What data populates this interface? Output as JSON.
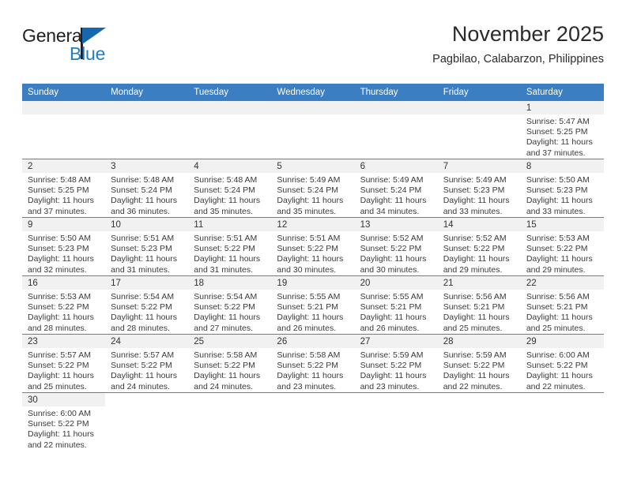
{
  "brand": {
    "name_dark": "General",
    "name_blue": "Blue",
    "accent_blue": "#1f7ec4",
    "header_blue": "#3b7ec1"
  },
  "header": {
    "title": "November 2025",
    "subtitle": "Pagbilao, Calabarzon, Philippines"
  },
  "weekdays": [
    "Sunday",
    "Monday",
    "Tuesday",
    "Wednesday",
    "Thursday",
    "Friday",
    "Saturday"
  ],
  "labels": {
    "sunrise_prefix": "Sunrise: ",
    "sunset_prefix": "Sunset: ",
    "daylight_prefix": "Daylight: "
  },
  "weeks": [
    [
      {
        "day": "",
        "empty": true
      },
      {
        "day": "",
        "empty": true
      },
      {
        "day": "",
        "empty": true
      },
      {
        "day": "",
        "empty": true
      },
      {
        "day": "",
        "empty": true
      },
      {
        "day": "",
        "empty": true
      },
      {
        "day": "1",
        "sunrise": "Sunrise: 5:47 AM",
        "sunset": "Sunset: 5:25 PM",
        "daylight": "Daylight: 11 hours and 37 minutes."
      }
    ],
    [
      {
        "day": "2",
        "sunrise": "Sunrise: 5:48 AM",
        "sunset": "Sunset: 5:25 PM",
        "daylight": "Daylight: 11 hours and 37 minutes."
      },
      {
        "day": "3",
        "sunrise": "Sunrise: 5:48 AM",
        "sunset": "Sunset: 5:24 PM",
        "daylight": "Daylight: 11 hours and 36 minutes."
      },
      {
        "day": "4",
        "sunrise": "Sunrise: 5:48 AM",
        "sunset": "Sunset: 5:24 PM",
        "daylight": "Daylight: 11 hours and 35 minutes."
      },
      {
        "day": "5",
        "sunrise": "Sunrise: 5:49 AM",
        "sunset": "Sunset: 5:24 PM",
        "daylight": "Daylight: 11 hours and 35 minutes."
      },
      {
        "day": "6",
        "sunrise": "Sunrise: 5:49 AM",
        "sunset": "Sunset: 5:24 PM",
        "daylight": "Daylight: 11 hours and 34 minutes."
      },
      {
        "day": "7",
        "sunrise": "Sunrise: 5:49 AM",
        "sunset": "Sunset: 5:23 PM",
        "daylight": "Daylight: 11 hours and 33 minutes."
      },
      {
        "day": "8",
        "sunrise": "Sunrise: 5:50 AM",
        "sunset": "Sunset: 5:23 PM",
        "daylight": "Daylight: 11 hours and 33 minutes."
      }
    ],
    [
      {
        "day": "9",
        "sunrise": "Sunrise: 5:50 AM",
        "sunset": "Sunset: 5:23 PM",
        "daylight": "Daylight: 11 hours and 32 minutes."
      },
      {
        "day": "10",
        "sunrise": "Sunrise: 5:51 AM",
        "sunset": "Sunset: 5:23 PM",
        "daylight": "Daylight: 11 hours and 31 minutes."
      },
      {
        "day": "11",
        "sunrise": "Sunrise: 5:51 AM",
        "sunset": "Sunset: 5:22 PM",
        "daylight": "Daylight: 11 hours and 31 minutes."
      },
      {
        "day": "12",
        "sunrise": "Sunrise: 5:51 AM",
        "sunset": "Sunset: 5:22 PM",
        "daylight": "Daylight: 11 hours and 30 minutes."
      },
      {
        "day": "13",
        "sunrise": "Sunrise: 5:52 AM",
        "sunset": "Sunset: 5:22 PM",
        "daylight": "Daylight: 11 hours and 30 minutes."
      },
      {
        "day": "14",
        "sunrise": "Sunrise: 5:52 AM",
        "sunset": "Sunset: 5:22 PM",
        "daylight": "Daylight: 11 hours and 29 minutes."
      },
      {
        "day": "15",
        "sunrise": "Sunrise: 5:53 AM",
        "sunset": "Sunset: 5:22 PM",
        "daylight": "Daylight: 11 hours and 29 minutes."
      }
    ],
    [
      {
        "day": "16",
        "sunrise": "Sunrise: 5:53 AM",
        "sunset": "Sunset: 5:22 PM",
        "daylight": "Daylight: 11 hours and 28 minutes."
      },
      {
        "day": "17",
        "sunrise": "Sunrise: 5:54 AM",
        "sunset": "Sunset: 5:22 PM",
        "daylight": "Daylight: 11 hours and 28 minutes."
      },
      {
        "day": "18",
        "sunrise": "Sunrise: 5:54 AM",
        "sunset": "Sunset: 5:22 PM",
        "daylight": "Daylight: 11 hours and 27 minutes."
      },
      {
        "day": "19",
        "sunrise": "Sunrise: 5:55 AM",
        "sunset": "Sunset: 5:21 PM",
        "daylight": "Daylight: 11 hours and 26 minutes."
      },
      {
        "day": "20",
        "sunrise": "Sunrise: 5:55 AM",
        "sunset": "Sunset: 5:21 PM",
        "daylight": "Daylight: 11 hours and 26 minutes."
      },
      {
        "day": "21",
        "sunrise": "Sunrise: 5:56 AM",
        "sunset": "Sunset: 5:21 PM",
        "daylight": "Daylight: 11 hours and 25 minutes."
      },
      {
        "day": "22",
        "sunrise": "Sunrise: 5:56 AM",
        "sunset": "Sunset: 5:21 PM",
        "daylight": "Daylight: 11 hours and 25 minutes."
      }
    ],
    [
      {
        "day": "23",
        "sunrise": "Sunrise: 5:57 AM",
        "sunset": "Sunset: 5:22 PM",
        "daylight": "Daylight: 11 hours and 25 minutes."
      },
      {
        "day": "24",
        "sunrise": "Sunrise: 5:57 AM",
        "sunset": "Sunset: 5:22 PM",
        "daylight": "Daylight: 11 hours and 24 minutes."
      },
      {
        "day": "25",
        "sunrise": "Sunrise: 5:58 AM",
        "sunset": "Sunset: 5:22 PM",
        "daylight": "Daylight: 11 hours and 24 minutes."
      },
      {
        "day": "26",
        "sunrise": "Sunrise: 5:58 AM",
        "sunset": "Sunset: 5:22 PM",
        "daylight": "Daylight: 11 hours and 23 minutes."
      },
      {
        "day": "27",
        "sunrise": "Sunrise: 5:59 AM",
        "sunset": "Sunset: 5:22 PM",
        "daylight": "Daylight: 11 hours and 23 minutes."
      },
      {
        "day": "28",
        "sunrise": "Sunrise: 5:59 AM",
        "sunset": "Sunset: 5:22 PM",
        "daylight": "Daylight: 11 hours and 22 minutes."
      },
      {
        "day": "29",
        "sunrise": "Sunrise: 6:00 AM",
        "sunset": "Sunset: 5:22 PM",
        "daylight": "Daylight: 11 hours and 22 minutes."
      }
    ],
    [
      {
        "day": "30",
        "sunrise": "Sunrise: 6:00 AM",
        "sunset": "Sunset: 5:22 PM",
        "daylight": "Daylight: 11 hours and 22 minutes."
      },
      {
        "day": "",
        "blank": true
      },
      {
        "day": "",
        "blank": true
      },
      {
        "day": "",
        "blank": true
      },
      {
        "day": "",
        "blank": true
      },
      {
        "day": "",
        "blank": true
      },
      {
        "day": "",
        "blank": true
      }
    ]
  ]
}
